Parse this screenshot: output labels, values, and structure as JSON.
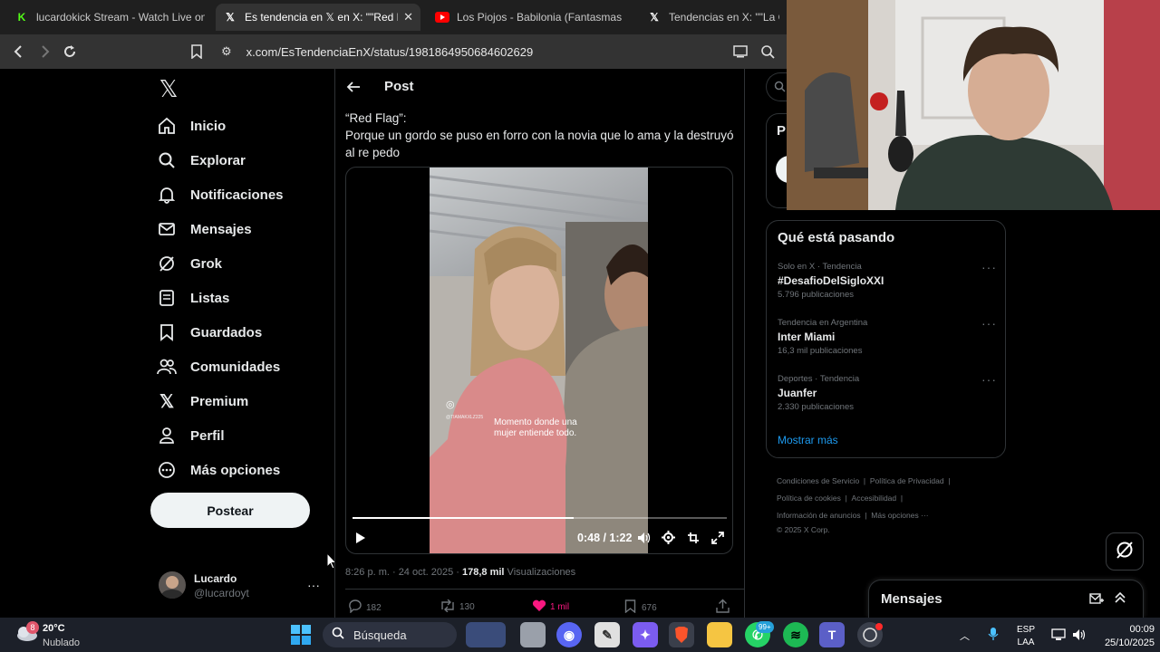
{
  "browser": {
    "tabs": [
      {
        "title": "lucardokick Stream - Watch Live on K",
        "favicon": "kick-icon",
        "color": "#53fc18",
        "active": false
      },
      {
        "title": "Es tendencia en 𝕏 en X: \"\"Red Fla",
        "favicon": "x-icon",
        "color": "#ffffff",
        "active": true
      },
      {
        "title": "Los Piojos - Babilonia (Fantasmas pel",
        "favicon": "youtube-icon",
        "color": "#ff0000",
        "active": false
      },
      {
        "title": "Tendencias en X: \"\"La Cobra",
        "favicon": "x-icon",
        "color": "#ffffff",
        "active": false
      }
    ],
    "url": "x.com/EsTendenciaEnX/status/1981864950684602629"
  },
  "sidebar": {
    "items": [
      {
        "label": "Inicio",
        "icon": "home-icon"
      },
      {
        "label": "Explorar",
        "icon": "search-icon"
      },
      {
        "label": "Notificaciones",
        "icon": "bell-icon"
      },
      {
        "label": "Mensajes",
        "icon": "mail-icon"
      },
      {
        "label": "Grok",
        "icon": "grok-icon"
      },
      {
        "label": "Listas",
        "icon": "list-icon"
      },
      {
        "label": "Guardados",
        "icon": "bookmark-icon"
      },
      {
        "label": "Comunidades",
        "icon": "people-icon"
      },
      {
        "label": "Premium",
        "icon": "x-icon"
      },
      {
        "label": "Perfil",
        "icon": "person-icon"
      },
      {
        "label": "Más opciones",
        "icon": "more-circle-icon"
      }
    ],
    "post_button": "Postear",
    "account": {
      "name": "Lucardo",
      "handle": "@lucardoyt",
      "more": "···"
    }
  },
  "post": {
    "header": "Post",
    "text_line1": "“Red Flag”:",
    "text_line2": "Porque un gordo se puso en forro con la novia que lo ama y la destruyó al re pedo",
    "video": {
      "caption": "Momento donde una mujer entiende todo.",
      "watermark": "@TIAMAKXLZ225",
      "time": "0:48 / 1:22",
      "progress": 0.59
    },
    "meta_time": "8:26 p. m. · 24 oct. 2025 · ",
    "views_count": "178,8 mil",
    "views_label": " Visualizaciones",
    "actions": {
      "replies": "182",
      "reposts": "130",
      "likes": "1 mil",
      "bookmarks": "676"
    }
  },
  "right": {
    "header_partial": "P",
    "trends_title": "Qué está pasando",
    "trends": [
      {
        "category": "Solo en X · Tendencia",
        "name": "#DesafioDelSigloXXI",
        "count": "5.796 publicaciones"
      },
      {
        "category": "Tendencia en Argentina",
        "name": "Inter Miami",
        "count": "16,3 mil publicaciones"
      },
      {
        "category": "Deportes · Tendencia",
        "name": "Juanfer",
        "count": "2.330 publicaciones"
      }
    ],
    "show_more": "Mostrar más",
    "footer": {
      "l1a": "Condiciones de Servicio",
      "l1b": "Política de Privacidad",
      "l2a": "Política de cookies",
      "l2b": "Accesibilidad",
      "l3a": "Información de anuncios",
      "l3b": "Más opciones ···",
      "l4": "© 2025 X Corp."
    },
    "messages_title": "Mensajes"
  },
  "taskbar": {
    "weather_temp": "20°C",
    "weather_desc": "Nublado",
    "weather_badge": "8",
    "search_label": "Búsqueda",
    "whatsapp_badge": "99+",
    "lang1": "ESP",
    "lang2": "LAA",
    "time": "00:09",
    "date": "25/10/2025"
  },
  "colors": {
    "x_blue": "#1d9bf0",
    "like_pink": "#f91880",
    "taskbar": "#1c2029"
  }
}
